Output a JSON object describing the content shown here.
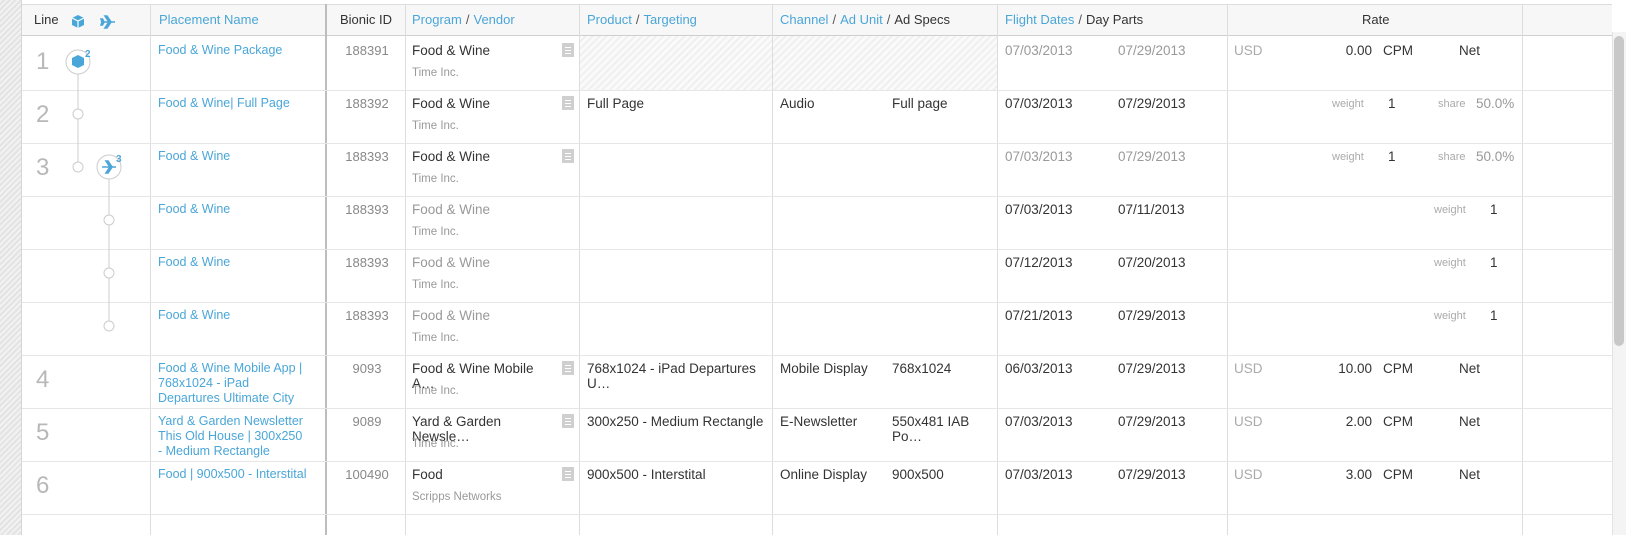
{
  "header": {
    "line": "Line",
    "placement_name": "Placement Name",
    "bionic_id": "Bionic ID",
    "program": "Program",
    "vendor": "Vendor",
    "product": "Product",
    "targeting": "Targeting",
    "channel": "Channel",
    "ad_unit": "Ad Unit",
    "ad_specs": "Ad Specs",
    "flight_dates": "Flight Dates",
    "day_parts": "Day Parts",
    "rate": "Rate",
    "slash": "/",
    "package_icon": "package-icon",
    "flight-icon": "airplane-icon"
  },
  "rows": [
    {
      "line": "1",
      "name": "Food & Wine Package",
      "bid": "188391",
      "program": "Food & Wine",
      "vendor": "Time Inc.",
      "product": "",
      "channel": "",
      "adspec": "",
      "d1": "07/03/2013",
      "d2": "07/29/2013",
      "currency": "USD",
      "amount": "0.00",
      "cpm": "CPM",
      "net": "Net",
      "badge": "2"
    },
    {
      "line": "2",
      "name": "Food & Wine| Full Page",
      "bid": "188392",
      "program": "Food & Wine",
      "vendor": "Time Inc.",
      "product": "Full Page",
      "channel": "Audio",
      "adspec": "Full page",
      "d1": "07/03/2013",
      "d2": "07/29/2013",
      "weight_label": "weight",
      "weight": "1",
      "share_label": "share",
      "share": "50.0%"
    },
    {
      "line": "3",
      "name": "Food & Wine",
      "bid": "188393",
      "program": "Food & Wine",
      "vendor": "Time Inc.",
      "product": "",
      "channel": "",
      "adspec": "",
      "d1": "07/03/2013",
      "d2": "07/29/2013",
      "weight_label": "weight",
      "weight": "1",
      "share_label": "share",
      "share": "50.0%",
      "badge": "3"
    },
    {
      "line": "",
      "name": "Food & Wine",
      "bid": "188393",
      "program": "Food & Wine",
      "vendor": "Time Inc.",
      "d1": "07/03/2013",
      "d2": "07/11/2013",
      "weight_label": "weight",
      "weight": "1"
    },
    {
      "line": "",
      "name": "Food & Wine",
      "bid": "188393",
      "program": "Food & Wine",
      "vendor": "Time Inc.",
      "d1": "07/12/2013",
      "d2": "07/20/2013",
      "weight_label": "weight",
      "weight": "1"
    },
    {
      "line": "",
      "name": "Food & Wine",
      "bid": "188393",
      "program": "Food & Wine",
      "vendor": "Time Inc.",
      "d1": "07/21/2013",
      "d2": "07/29/2013",
      "weight_label": "weight",
      "weight": "1"
    },
    {
      "line": "4",
      "name": "Food & Wine Mobile App | 768x1024 - iPad Departures Ultimate City",
      "bid": "9093",
      "program": "Food & Wine Mobile A…",
      "vendor": "Time Inc.",
      "product": "768x1024 - iPad Departures U…",
      "channel": "Mobile Display",
      "adspec": "768x1024",
      "d1": "06/03/2013",
      "d2": "07/29/2013",
      "currency": "USD",
      "amount": "10.00",
      "cpm": "CPM",
      "net": "Net"
    },
    {
      "line": "5",
      "name": "Yard & Garden Newsletter This Old House | 300x250 - Medium Rectangle",
      "bid": "9089",
      "program": "Yard & Garden Newsle…",
      "vendor": "Time Inc.",
      "product": "300x250 - Medium Rectangle",
      "channel": "E-Newsletter",
      "adspec": "550x481 IAB Po…",
      "d1": "07/03/2013",
      "d2": "07/29/2013",
      "currency": "USD",
      "amount": "2.00",
      "cpm": "CPM",
      "net": "Net"
    },
    {
      "line": "6",
      "name": "Food | 900x500 - Interstital",
      "bid": "100490",
      "program": "Food",
      "vendor": "Scripps Networks",
      "product": "900x500 - Interstital",
      "channel": "Online Display",
      "adspec": "900x500",
      "d1": "07/03/2013",
      "d2": "07/29/2013",
      "currency": "USD",
      "amount": "3.00",
      "cpm": "CPM",
      "net": "Net"
    }
  ]
}
